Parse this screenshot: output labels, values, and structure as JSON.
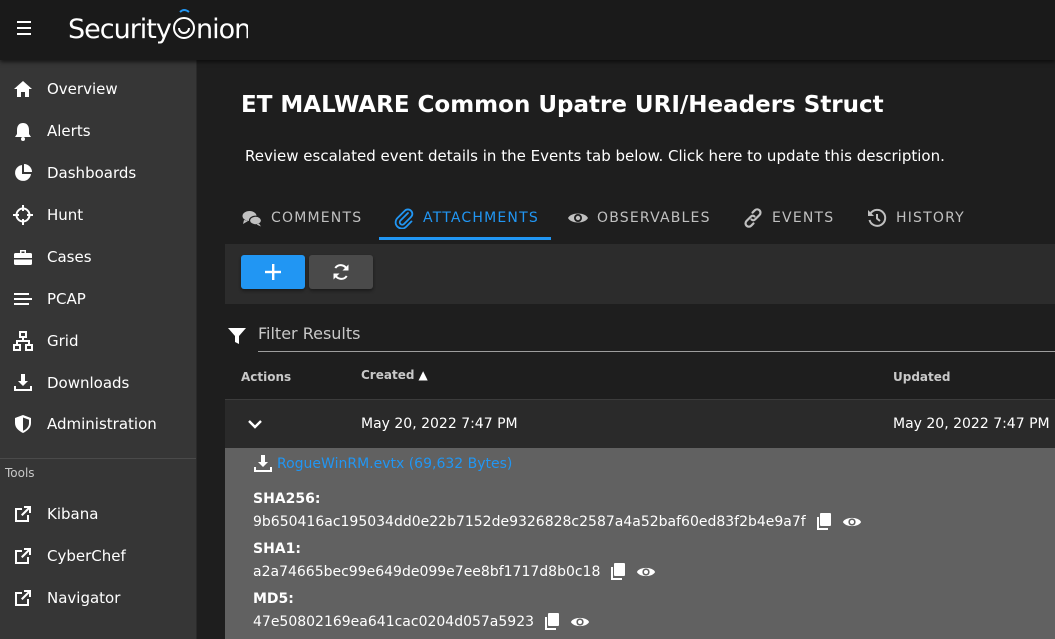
{
  "app": {
    "brand": "SecurityOnion"
  },
  "sidebar": {
    "items": [
      {
        "label": "Overview",
        "icon": "home-icon"
      },
      {
        "label": "Alerts",
        "icon": "bell-icon"
      },
      {
        "label": "Dashboards",
        "icon": "pie-chart-icon"
      },
      {
        "label": "Hunt",
        "icon": "crosshairs-icon"
      },
      {
        "label": "Cases",
        "icon": "briefcase-icon"
      },
      {
        "label": "PCAP",
        "icon": "list-icon"
      },
      {
        "label": "Grid",
        "icon": "sitemap-icon"
      },
      {
        "label": "Downloads",
        "icon": "download-icon"
      },
      {
        "label": "Administration",
        "icon": "shield-icon"
      }
    ],
    "tools_header": "Tools",
    "tools": [
      {
        "label": "Kibana",
        "icon": "external-link-icon"
      },
      {
        "label": "CyberChef",
        "icon": "external-link-icon"
      },
      {
        "label": "Navigator",
        "icon": "external-link-icon"
      }
    ]
  },
  "case": {
    "title": "ET MALWARE Common Upatre URI/Headers Struct",
    "description": "Review escalated event details in the Events tab below. Click here to update this description."
  },
  "tabs": [
    {
      "label": "COMMENTS",
      "icon": "comments-icon"
    },
    {
      "label": "ATTACHMENTS",
      "icon": "paperclip-icon",
      "active": true
    },
    {
      "label": "OBSERVABLES",
      "icon": "eye-icon"
    },
    {
      "label": "EVENTS",
      "icon": "link-icon"
    },
    {
      "label": "HISTORY",
      "icon": "history-icon"
    }
  ],
  "filter": {
    "placeholder": "Filter Results"
  },
  "table": {
    "headers": {
      "actions": "Actions",
      "created": "Created",
      "updated": "Updated"
    },
    "sort": "created-ascending",
    "rows": [
      {
        "created": "May 20, 2022 7:47 PM",
        "updated": "May 20, 2022 7:47 PM",
        "expanded": true,
        "details": {
          "download_link": "RogueWinRM.evtx (69,632 Bytes)",
          "sha256_label": "SHA256:",
          "sha256": "9b650416ac195034dd0e22b7152de9326828c2587a4a52baf60ed83f2b4e9a7f",
          "sha1_label": "SHA1:",
          "sha1": "a2a74665bec99e649de099e7ee8bf1717d8b0c18",
          "md5_label": "MD5:",
          "md5": "47e50802169ea641cac0204d057a5923"
        }
      }
    ]
  },
  "colors": {
    "accent": "#2196f3",
    "sidebar_bg": "#363636",
    "topbar_bg": "#1a1a1a",
    "details_bg": "#616161"
  }
}
